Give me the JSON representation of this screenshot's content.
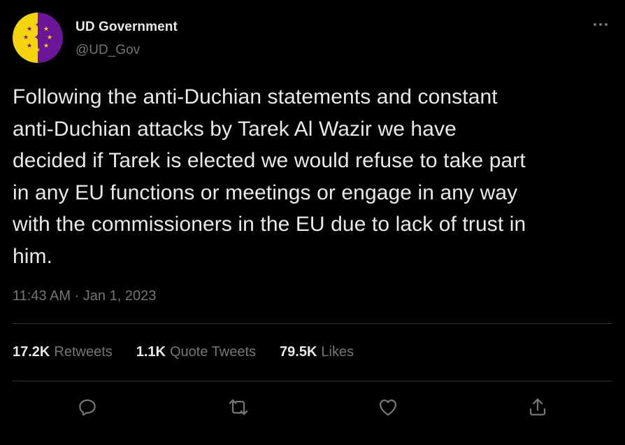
{
  "author": {
    "display_name": "UD Government",
    "handle": "@UD_Gov",
    "avatar_icon": "ud-flag-icon"
  },
  "more_icon": "ellipsis-icon",
  "tweet": {
    "text": "Following the anti-Duchian statements and constant\nanti-Duchian attacks by Tarek Al Wazir we have\ndecided if Tarek is elected we would refuse to take part\nin any EU functions or meetings or engage in any way\nwith the commissioners in the EU due to lack of trust in\nhim.",
    "timestamp": "11:43 AM · Jan 1, 2023"
  },
  "stats": {
    "retweets": {
      "count": "17.2K",
      "label": "Retweets"
    },
    "quotes": {
      "count": "1.1K",
      "label": "Quote Tweets"
    },
    "likes": {
      "count": "79.5K",
      "label": "Likes"
    }
  },
  "actions": {
    "reply_icon": "reply-icon",
    "retweet_icon": "retweet-icon",
    "like_icon": "heart-icon",
    "share_icon": "share-icon"
  },
  "colors": {
    "background": "#000000",
    "text_primary": "#e7e9ea",
    "text_secondary": "#71767b",
    "divider": "#2f3336",
    "avatar_yellow": "#f6d40c",
    "avatar_purple": "#6b1599"
  }
}
